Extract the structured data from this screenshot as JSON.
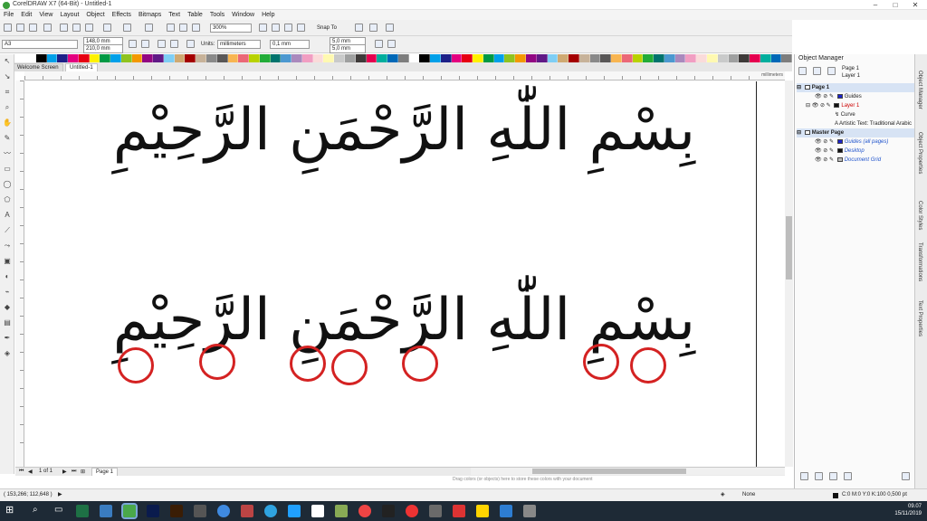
{
  "window": {
    "title": "CorelDRAW X7 (64-Bit) - Untitled-1"
  },
  "menu": [
    "File",
    "Edit",
    "View",
    "Layout",
    "Object",
    "Effects",
    "Bitmaps",
    "Text",
    "Table",
    "Tools",
    "Window",
    "Help"
  ],
  "toolbar": {
    "zoom": "300%",
    "snap_label": "Snap To"
  },
  "propbar": {
    "page_size": "A3",
    "width": "148,0 mm",
    "height": "210,0 mm",
    "units_label": "Units:",
    "units": "millimeters",
    "nudge": "0,1 mm",
    "dup_x": "5,0 mm",
    "dup_y": "5,0 mm"
  },
  "tabs": [
    "Welcome Screen",
    "Untitled-1"
  ],
  "ruler": {
    "unit": "millimeters"
  },
  "canvas": {
    "line1": "بِسْمِ اللّٰهِ الرَّحْمَنِ الرَّحِيْمِ",
    "line2": "بِسْمِ اللّٰهِ الرَّحْمَنِ الرَّحِيْمِ"
  },
  "pagebar": {
    "counter": "1 of 1",
    "page_tab": "Page 1"
  },
  "hint": "Drag colors (or objects) here to store these colors with your document",
  "status": {
    "coords": "( 153,266; 112,648 )",
    "fill": "None",
    "outline": "C:0 M:0 Y:0 K:100  0,500 pt"
  },
  "docker": {
    "title": "Object Manager",
    "page": "Page 1",
    "layer_current": "Layer 1",
    "items": [
      {
        "label": "Page 1",
        "style": "bold"
      },
      {
        "label": "Guides",
        "style": "normal"
      },
      {
        "label": "Layer 1",
        "style": "red"
      },
      {
        "label": "Curve",
        "style": "normal"
      },
      {
        "label": "Artistic Text: Traditional Arabic",
        "style": "normal"
      },
      {
        "label": "Master Page",
        "style": "bold"
      },
      {
        "label": "Guides (all pages)",
        "style": "blue"
      },
      {
        "label": "Desktop",
        "style": "blue"
      },
      {
        "label": "Document Grid",
        "style": "blue"
      }
    ]
  },
  "sidetabs": [
    "Object Manager",
    "Object Properties",
    "Color Styles",
    "Transformations",
    "Text Properties"
  ],
  "taskbar": {
    "time": "09.07",
    "date": "15/11/2019"
  },
  "colors": {
    "highlight_circle": "#d42222",
    "layer_red": "#cc0000",
    "link_blue": "#2255cc"
  }
}
